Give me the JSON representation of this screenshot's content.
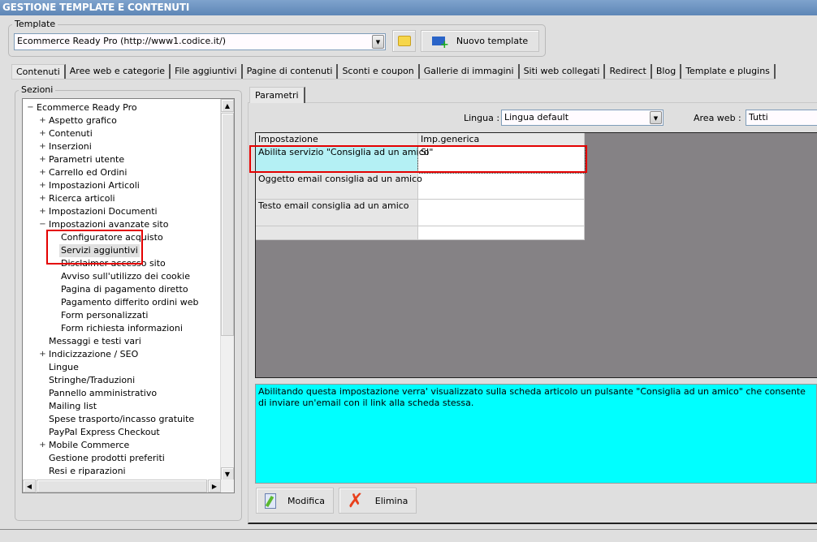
{
  "window_title": "GESTIONE TEMPLATE E CONTENUTI",
  "template": {
    "legend": "Template",
    "selected": "Ecommerce Ready Pro (http://www1.codice.it/)",
    "new_button": "Nuovo template"
  },
  "main_tabs": [
    "Contenuti",
    "Aree web e categorie",
    "File aggiuntivi",
    "Pagine di contenuti",
    "Sconti e coupon",
    "Gallerie di immagini",
    "Siti web collegati",
    "Redirect",
    "Blog",
    "Template e plugins"
  ],
  "sections": {
    "legend": "Sezioni",
    "items": [
      {
        "label": "Ecommerce Ready Pro",
        "level": 0,
        "exp": "-"
      },
      {
        "label": "Aspetto grafico",
        "level": 1,
        "exp": "+"
      },
      {
        "label": "Contenuti",
        "level": 1,
        "exp": "+"
      },
      {
        "label": "Inserzioni",
        "level": 1,
        "exp": "+"
      },
      {
        "label": "Parametri utente",
        "level": 1,
        "exp": "+"
      },
      {
        "label": "Carrello ed Ordini",
        "level": 1,
        "exp": "+"
      },
      {
        "label": "Impostazioni Articoli",
        "level": 1,
        "exp": "+"
      },
      {
        "label": "Ricerca articoli",
        "level": 1,
        "exp": "+"
      },
      {
        "label": "Impostazioni Documenti",
        "level": 1,
        "exp": "+"
      },
      {
        "label": "Impostazioni avanzate sito",
        "level": 1,
        "exp": "-"
      },
      {
        "label": "Configuratore acquisto",
        "level": 2,
        "exp": ""
      },
      {
        "label": "Servizi aggiuntivi",
        "level": 2,
        "exp": "",
        "selected": true
      },
      {
        "label": "Disclaimer accesso sito",
        "level": 2,
        "exp": ""
      },
      {
        "label": "Avviso sull'utilizzo dei cookie",
        "level": 2,
        "exp": ""
      },
      {
        "label": "Pagina di pagamento diretto",
        "level": 2,
        "exp": ""
      },
      {
        "label": "Pagamento differito ordini web",
        "level": 2,
        "exp": ""
      },
      {
        "label": "Form personalizzati",
        "level": 2,
        "exp": ""
      },
      {
        "label": "Form richiesta informazioni",
        "level": 2,
        "exp": ""
      },
      {
        "label": "Messaggi e testi vari",
        "level": 1,
        "exp": ""
      },
      {
        "label": "Indicizzazione / SEO",
        "level": 1,
        "exp": "+"
      },
      {
        "label": "Lingue",
        "level": 1,
        "exp": ""
      },
      {
        "label": "Stringhe/Traduzioni",
        "level": 1,
        "exp": ""
      },
      {
        "label": "Pannello amministrativo",
        "level": 1,
        "exp": ""
      },
      {
        "label": "Mailing list",
        "level": 1,
        "exp": ""
      },
      {
        "label": "Spese trasporto/incasso gratuite",
        "level": 1,
        "exp": ""
      },
      {
        "label": "PayPal Express Checkout",
        "level": 1,
        "exp": ""
      },
      {
        "label": "Mobile Commerce",
        "level": 1,
        "exp": "+"
      },
      {
        "label": "Gestione prodotti preferiti",
        "level": 1,
        "exp": ""
      },
      {
        "label": "Resi e riparazioni",
        "level": 1,
        "exp": ""
      }
    ]
  },
  "params": {
    "tab": "Parametri",
    "lingua_label": "Lingua :",
    "lingua_value": "Lingua default",
    "area_label": "Area web :",
    "area_value": "Tutti",
    "columns": [
      "Impostazione",
      "Imp.generica"
    ],
    "rows": [
      [
        "Abilita servizio \"Consiglia ad un amico\"",
        "SI"
      ],
      [
        "Oggetto email consiglia ad un amico",
        ""
      ],
      [
        "Testo email consiglia ad un amico",
        ""
      ],
      [
        "",
        ""
      ]
    ],
    "description": "Abilitando questa impostazione verra' visualizzato sulla scheda articolo un pulsante \"Consiglia ad un amico\" che consente di inviare un'email con il link alla scheda stessa.",
    "modify": "Modifica",
    "delete": "Elimina"
  }
}
